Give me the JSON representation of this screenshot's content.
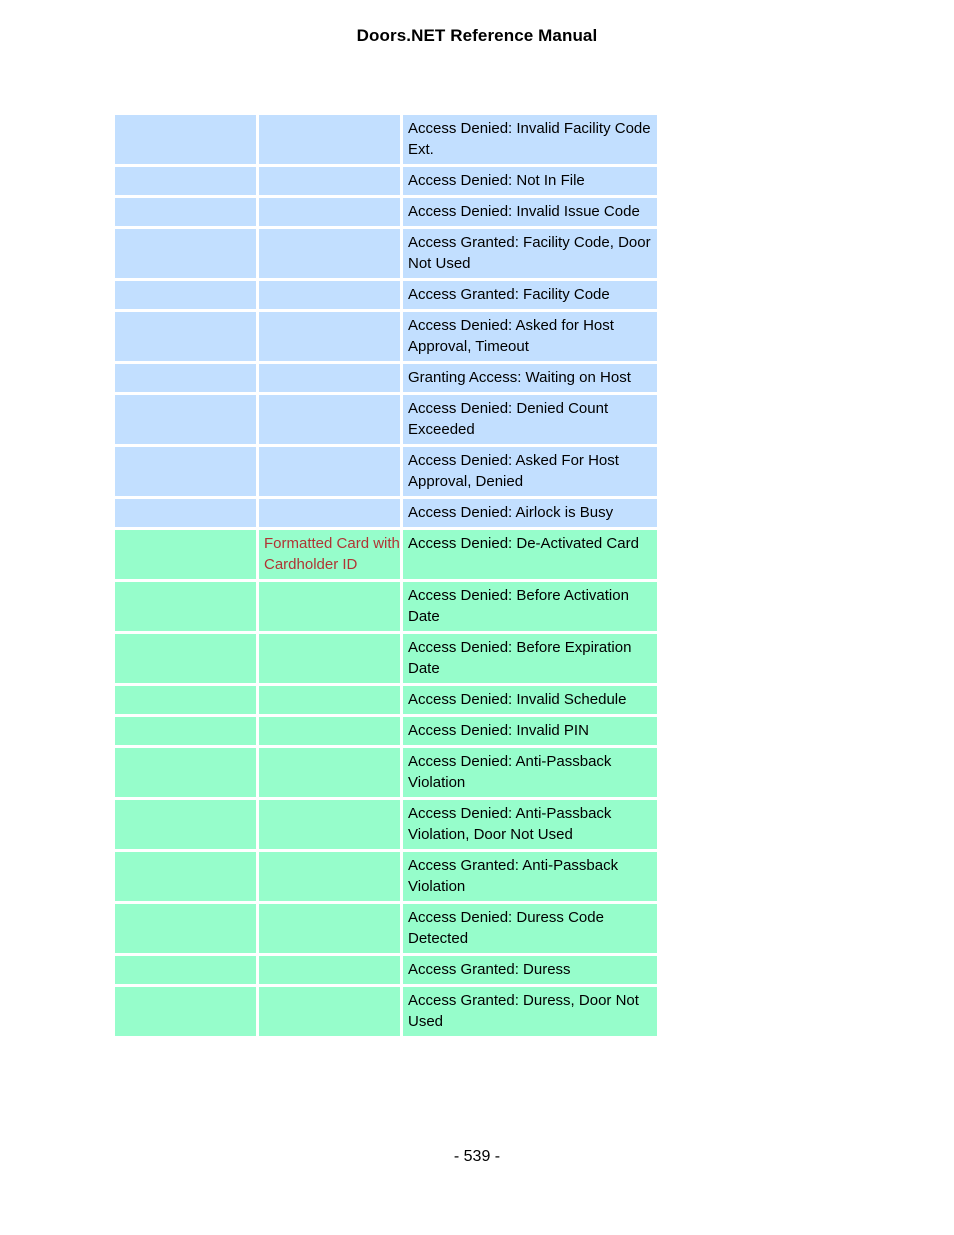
{
  "header": {
    "title": "Doors.NET Reference Manual"
  },
  "footer": {
    "page_number": "- 539 -"
  },
  "colors": {
    "blue_row": "#c2dfff",
    "green_row": "#96fdcb",
    "label_text": "#b03434",
    "body_text": "#000000",
    "page_background": "#ffffff"
  },
  "table": {
    "columns": 3,
    "rows": [
      {
        "group": "blue",
        "col1": "",
        "col2": "",
        "col3": "Access Denied: Invalid Facility Code Ext."
      },
      {
        "group": "blue",
        "col1": "",
        "col2": "",
        "col3": "Access Denied: Not In File"
      },
      {
        "group": "blue",
        "col1": "",
        "col2": "",
        "col3": "Access Denied: Invalid Issue Code"
      },
      {
        "group": "blue",
        "col1": "",
        "col2": "",
        "col3": "Access Granted: Facility Code, Door Not Used"
      },
      {
        "group": "blue",
        "col1": "",
        "col2": "",
        "col3": "Access Granted: Facility Code"
      },
      {
        "group": "blue",
        "col1": "",
        "col2": "",
        "col3": "Access Denied: Asked for Host Approval, Timeout"
      },
      {
        "group": "blue",
        "col1": "",
        "col2": "",
        "col3": "Granting Access: Waiting on Host"
      },
      {
        "group": "blue",
        "col1": "",
        "col2": "",
        "col3": "Access Denied: Denied Count Exceeded"
      },
      {
        "group": "blue",
        "col1": "",
        "col2": "",
        "col3": "Access Denied: Asked For Host Approval, Denied"
      },
      {
        "group": "blue",
        "col1": "",
        "col2": "",
        "col3": "Access Denied: Airlock is Busy"
      },
      {
        "group": "green",
        "col1": "",
        "col2": "Formatted Card with Cardholder ID",
        "col3": "Access Denied: De-Activated Card"
      },
      {
        "group": "green",
        "col1": "",
        "col2": "",
        "col3": "Access Denied: Before Activation Date"
      },
      {
        "group": "green",
        "col1": "",
        "col2": "",
        "col3": "Access Denied: Before Expiration Date"
      },
      {
        "group": "green",
        "col1": "",
        "col2": "",
        "col3": "Access Denied: Invalid Schedule"
      },
      {
        "group": "green",
        "col1": "",
        "col2": "",
        "col3": "Access Denied: Invalid PIN"
      },
      {
        "group": "green",
        "col1": "",
        "col2": "",
        "col3": "Access Denied: Anti-Passback Violation"
      },
      {
        "group": "green",
        "col1": "",
        "col2": "",
        "col3": "Access Denied: Anti-Passback Violation, Door Not Used"
      },
      {
        "group": "green",
        "col1": "",
        "col2": "",
        "col3": "Access Granted: Anti-Passback Violation"
      },
      {
        "group": "green",
        "col1": "",
        "col2": "",
        "col3": "Access Denied: Duress Code Detected"
      },
      {
        "group": "green",
        "col1": "",
        "col2": "",
        "col3": "Access Granted: Duress"
      },
      {
        "group": "green",
        "col1": "",
        "col2": "",
        "col3": "Access Granted: Duress, Door Not Used"
      }
    ]
  }
}
